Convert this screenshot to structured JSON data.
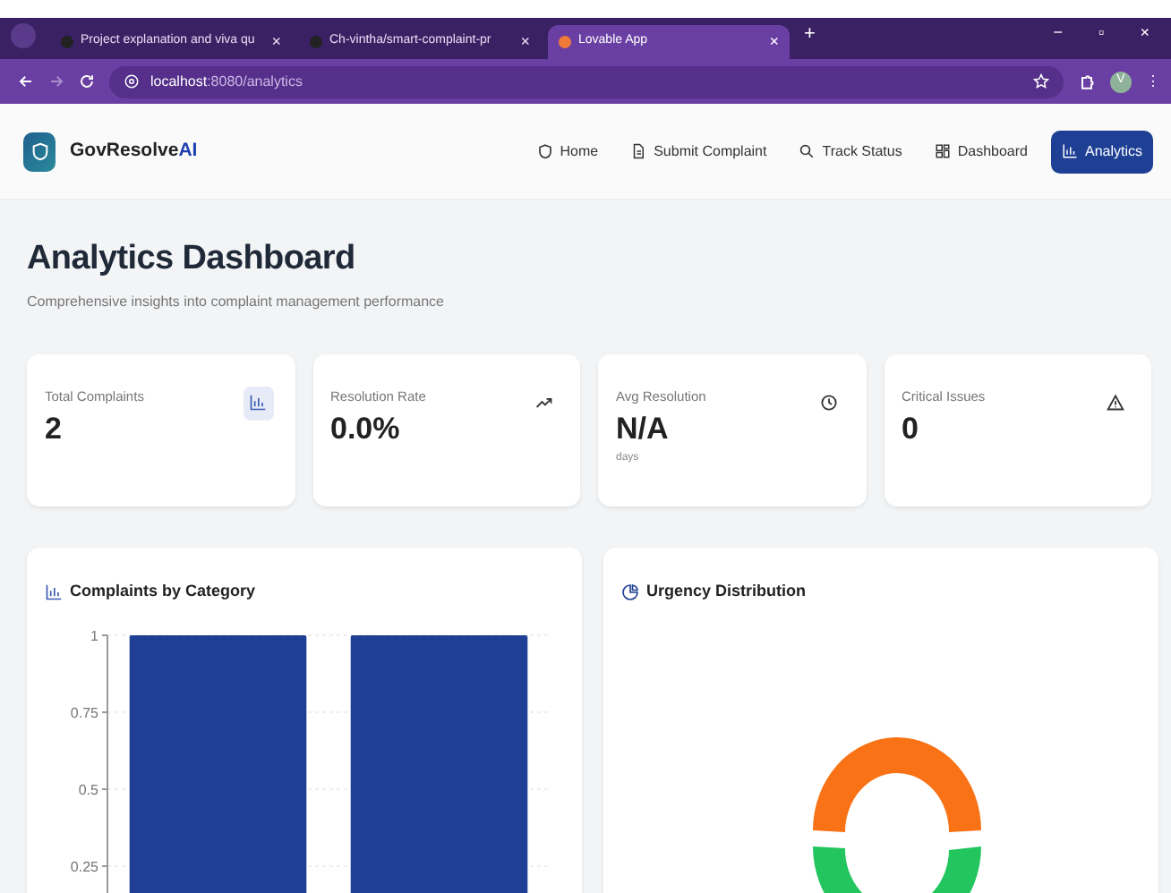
{
  "browser": {
    "tabs": [
      {
        "title": "Project explanation and viva qu",
        "close": "×",
        "selected": false
      },
      {
        "title": "Ch-vintha/smart-complaint-pr",
        "close": "×",
        "selected": false
      },
      {
        "title": "Lovable App",
        "close": "×",
        "selected": true
      }
    ],
    "new_tab": "+",
    "controls": [
      "−",
      "▫",
      "×"
    ],
    "url": "**localhost**:8080/analytics",
    "profile": "V",
    "menu": "⋮"
  },
  "app": {
    "brand": "GovResolve",
    "brand_accent": "AI",
    "nav": [
      {
        "label": "Home",
        "kind": "shield",
        "selected": false
      },
      {
        "label": "Submit Complaint",
        "kind": "doc",
        "selected": false
      },
      {
        "label": "Track Status",
        "kind": "search",
        "selected": false
      },
      {
        "label": "Dashboard",
        "kind": "grid",
        "selected": false
      },
      {
        "label": "Analytics",
        "kind": "bars",
        "selected": true
      }
    ]
  },
  "page": {
    "title": "Analytics Dashboard",
    "subtitle": "Comprehensive insights into complaint management performance"
  },
  "stats": [
    {
      "label": "Total Complaints",
      "value": "2",
      "kind": "bars"
    },
    {
      "label": "Resolution Rate",
      "value": "0.0%",
      "kind": "trend"
    },
    {
      "label": "Avg Resolution",
      "value": "N/A",
      "sub": "days",
      "kind": "clock"
    },
    {
      "label": "Critical Issues",
      "value": "0",
      "kind": "warn"
    }
  ],
  "panels": [
    {
      "title": "Complaints by Category",
      "kind": "bars",
      "chart_data": {
        "type": "bar",
        "values": [
          1,
          1
        ],
        "ylim": [
          0,
          1
        ],
        "yticks": [
          0.25,
          0.5,
          0.75,
          1
        ],
        "grid": true
      }
    },
    {
      "title": "Urgency Distribution",
      "kind": "pie"
    }
  ]
}
